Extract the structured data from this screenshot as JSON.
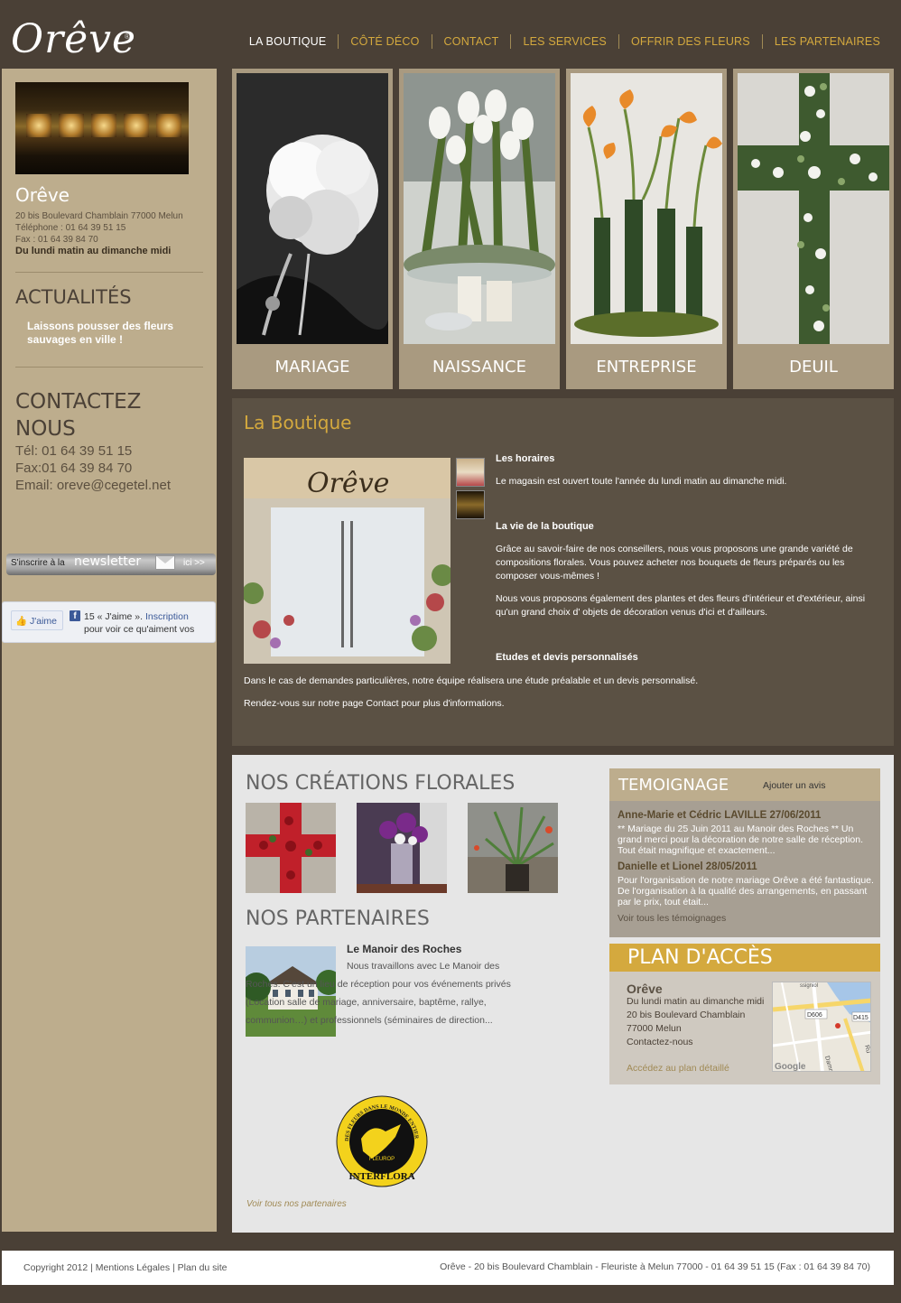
{
  "brand": {
    "logo_text": "Orêve",
    "logo_reg": "®"
  },
  "nav": [
    {
      "label": "LA BOUTIQUE"
    },
    {
      "label": "CÔTÉ DÉCO"
    },
    {
      "label": "CONTACT"
    },
    {
      "label": "LES SERVICES"
    },
    {
      "label": "OFFRIR DES FLEURS"
    },
    {
      "label": "LES PARTENAIRES"
    }
  ],
  "sidebar": {
    "shop_name": "Orêve",
    "address": "20 bis Boulevard Chamblain 77000 Melun",
    "phone": "Téléphone : 01 64 39 51 15",
    "fax": "Fax : 01 64 39 84 70",
    "hours": "Du lundi matin au dimanche midi",
    "news_heading": "ACTUALITÉS",
    "news_item": "Laissons pousser des fleurs sauvages en ville !",
    "contact_heading_1": "CONTACTEZ",
    "contact_heading_2": "NOUS",
    "contact_tel": "Tél: 01 64 39 51 15",
    "contact_fax": "Fax:01 64 39 84 70",
    "contact_email": "Email: oreve@cegetel.net",
    "newsletter": {
      "pre": "S'inscrire à la",
      "big": "newsletter",
      "link": "ici >>"
    },
    "facebook": {
      "button": "J'aime",
      "count_text": "15 « J'aime ».",
      "signup": "Inscription",
      "line2": "pour voir ce qu'aiment vos"
    }
  },
  "categories": [
    {
      "label": "MARIAGE"
    },
    {
      "label": "NAISSANCE"
    },
    {
      "label": "ENTREPRISE"
    },
    {
      "label": "DEUIL"
    }
  ],
  "boutique": {
    "title": "La Boutique",
    "img_sign": "Orêve",
    "h_hours": "Les horaires",
    "p_hours": "Le magasin est ouvert toute l'année du lundi matin au dimanche midi.",
    "h_life": "La vie de la boutique",
    "p_life_1": "Grâce au savoir-faire de nos conseillers, nous vous proposons une grande variété de compositions florales. Vous pouvez acheter nos bouquets de fleurs préparés ou les composer vous-mêmes !",
    "p_life_2": "Nous vous proposons également des plantes et des fleurs d'intérieur et d'extérieur, ainsi qu'un grand choix d' objets de décoration  venus d'ici et d'ailleurs.",
    "h_studies": "Etudes et devis personnalisés",
    "p_studies_1": "Dans le cas de demandes particulières, notre équipe réalisera une étude préalable et un devis personnalisé.",
    "p_studies_2": "Rendez-vous sur notre page Contact pour plus d'informations."
  },
  "creations": {
    "heading": "NOS CRÉATIONS FLORALES"
  },
  "partners": {
    "heading": "NOS PARTENAIRES",
    "name": "Le Manoir des Roches",
    "desc": "Nous travaillons avec Le Manoir des Roches. C'est un lieu de réception pour vos événements privés (Location salle de mariage, anniversaire, baptême, rallye, communion…) et professionnels (séminaires de direction...",
    "logo_top": "DES FLEURS DANS LE MONDE ENTIER",
    "logo_mid": "FLEUROP",
    "logo_bottom": "INTERFLORA",
    "all_link": "Voir tous nos partenaires"
  },
  "testimonials": {
    "heading": "TEMOIGNAGE",
    "add_link": "Ajouter un avis",
    "items": [
      {
        "who": "Anne-Marie et Cédric LAVILLE 27/06/2011",
        "msg": "** Mariage du 25 Juin 2011 au Manoir des Roches ** Un grand merci pour la décoration de notre salle de réception. Tout était magnifique et exactement..."
      },
      {
        "who": "Danielle et Lionel 28/05/2011",
        "msg": "Pour l'organisation de notre mariage Orêve a été fantastique. De l'organisation à la qualité des arrangements, en passant par le prix, tout était..."
      }
    ],
    "all_link": "Voir tous les témoignages"
  },
  "plan": {
    "heading": "PLAN D'ACCÈS",
    "name": "Orêve",
    "hours": "Du lundi matin au dimanche midi",
    "street": "20 bis Boulevard Chamblain",
    "city": "77000 Melun",
    "contact": "Contactez-nous",
    "link": "Accédez au plan détaillé",
    "map_labels": {
      "d606": "D606",
      "d415": "D415",
      "google": "Google",
      "street1": "Dammarie",
      "street2": "Ru",
      "street3": "ssigniol"
    }
  },
  "footer": {
    "left": "Copyright   2012 | Mentions Légales | Plan du site",
    "right": "Orêve - 20 bis Boulevard Chamblain - Fleuriste à Melun 77000 - 01 64 39 51 15 (Fax : 01 64 39 84 70)"
  }
}
